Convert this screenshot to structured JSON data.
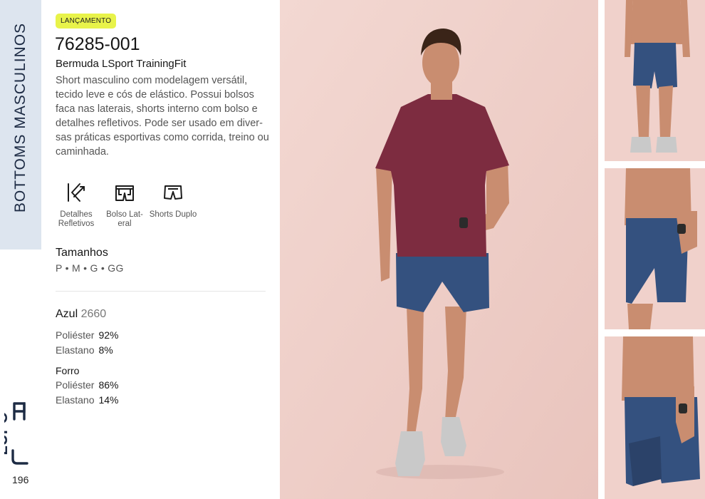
{
  "sidebar": {
    "section_title": "BOTTOMS MASCULINOS",
    "brand": "LUPO",
    "page_number": "196"
  },
  "product": {
    "badge": "LANÇAMENTO",
    "code": "76285-001",
    "name": "Bermuda LSport TrainingFit",
    "description": "Short masculino com modelagem versátil, tecido leve e cós de elástico. Possui bolsos faca nas laterais, shorts interno com bolso e detalhes refletivos. Pode ser usado em diver-sas práticas esportivas como corrida, treino ou caminhada.",
    "features": [
      {
        "icon": "reflective-details-icon",
        "label": "Detalhes Refletivos"
      },
      {
        "icon": "side-pocket-icon",
        "label": "Bolso Lat-eral"
      },
      {
        "icon": "double-shorts-icon",
        "label": "Shorts Duplo"
      }
    ],
    "sizes_title": "Tamanhos",
    "sizes": "P • M • G • GG",
    "color_name": "Azul",
    "color_code": "2660",
    "composition": [
      {
        "material": "Poliéster",
        "percent": "92%"
      },
      {
        "material": "Elastano",
        "percent": "8%"
      }
    ],
    "lining_title": "Forro",
    "lining_composition": [
      {
        "material": "Poliéster",
        "percent": "86%"
      },
      {
        "material": "Elastano",
        "percent": "14%"
      }
    ]
  },
  "colors": {
    "sidebar_band": "#dde5ef",
    "badge": "#e8f34a",
    "photo_background": "#f0d1cb",
    "shirt": "#7d2c40",
    "shorts": "#34517f"
  }
}
